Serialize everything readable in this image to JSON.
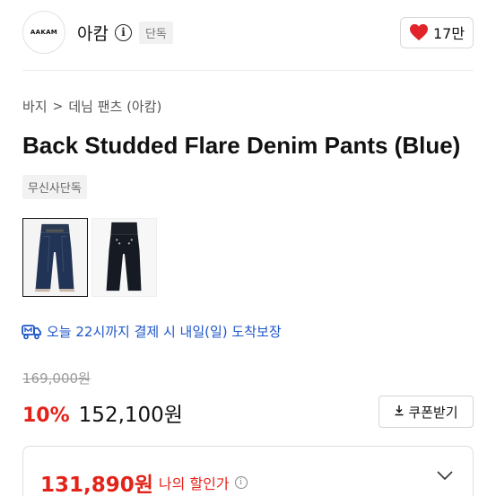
{
  "brand": {
    "logo_text": "AAKAM",
    "name": "아캄",
    "exclusive_tag": "단독",
    "likes": "17만"
  },
  "icons": {
    "heart": "heart-icon",
    "info": "info-icon",
    "truck": "delivery-truck-icon",
    "download": "download-icon",
    "chevron": "chevron-down-icon"
  },
  "breadcrumb": {
    "level1": "바지",
    "separator": ">",
    "level2": "데님 팬츠 (아캄)"
  },
  "product": {
    "title": "Back Studded Flare Denim Pants (Blue)",
    "store_tag": "무신사단독",
    "thumbnails": [
      "front-view",
      "back-view"
    ],
    "selected_thumbnail": 0
  },
  "delivery": {
    "text": "오늘 22시까지 결제 시 내일(일) 도착보장"
  },
  "price": {
    "original": "169,000원",
    "discount": "10%",
    "sale": "152,100원",
    "coupon_label": "쿠폰받기"
  },
  "my_price": {
    "amount": "131,890원",
    "label": "나의 할인가"
  },
  "colors": {
    "accent_red": "#e2231a",
    "delivery_blue": "#1e56c9",
    "heart_red": "#e1242a"
  }
}
